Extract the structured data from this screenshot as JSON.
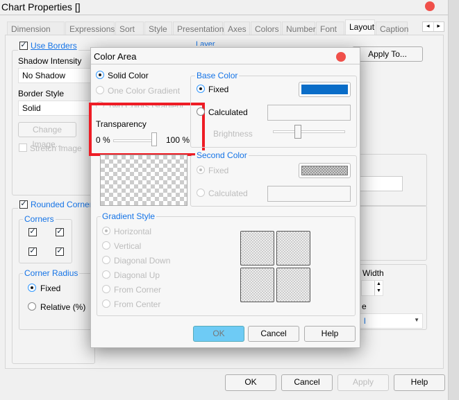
{
  "window": {
    "title": "Chart Properties []"
  },
  "tabs": [
    {
      "label": "Dimension Limits"
    },
    {
      "label": "Expressions"
    },
    {
      "label": "Sort"
    },
    {
      "label": "Style"
    },
    {
      "label": "Presentation"
    },
    {
      "label": "Axes"
    },
    {
      "label": "Colors"
    },
    {
      "label": "Number"
    },
    {
      "label": "Font"
    },
    {
      "label": "Layout",
      "active": true
    },
    {
      "label": "Caption"
    }
  ],
  "tab_scroll": {
    "left": "◂",
    "right": "▸"
  },
  "layout": {
    "use_borders": {
      "label": "Use Borders",
      "checked": true
    },
    "shadow_intensity_label": "Shadow Intensity",
    "shadow_intensity_value": "No Shadow",
    "border_style_label": "Border Style",
    "border_style_value": "Solid",
    "change_image": "Change Image...",
    "stretch_image": "Stretch Image",
    "layer_label": "Layer",
    "apply_to": "Apply To...",
    "rounded_corners": {
      "label": "Rounded Corners",
      "checked": true
    },
    "corners_label": "Corners",
    "corners": [
      true,
      true,
      true,
      true
    ],
    "corner_radius_label": "Corner Radius",
    "fixed": "Fixed",
    "relative": "Relative (%)",
    "width_label": "Width",
    "partial_label_e": "e",
    "partial_dropdown_value": "l"
  },
  "footer": {
    "ok": "OK",
    "cancel": "Cancel",
    "apply": "Apply",
    "help": "Help"
  },
  "color_area": {
    "title": "Color Area",
    "fill_modes": [
      {
        "label": "Solid Color",
        "selected": true,
        "enabled": true
      },
      {
        "label": "One Color Gradient",
        "enabled": false
      },
      {
        "label": "Two Colors Gradient",
        "enabled": false
      }
    ],
    "transparency_label": "Transparency",
    "transparency_min": "0 %",
    "transparency_max": "100 %",
    "transparency_value_percent": 100,
    "base_color": {
      "label": "Base Color",
      "fixed": "Fixed",
      "calculated": "Calculated",
      "brightness": "Brightness",
      "color": "#0a6dc8"
    },
    "second_color": {
      "label": "Second Color",
      "fixed": "Fixed",
      "calculated": "Calculated"
    },
    "gradient_style": {
      "label": "Gradient Style",
      "options": [
        "Horizontal",
        "Vertical",
        "Diagonal Down",
        "Diagonal Up",
        "From Corner",
        "From Center"
      ]
    },
    "ok": "OK",
    "cancel": "Cancel",
    "help": "Help"
  },
  "colors": {
    "accent": "#1473e6",
    "highlight": "#ee1c25",
    "ok_button": "#6ecbf5"
  }
}
